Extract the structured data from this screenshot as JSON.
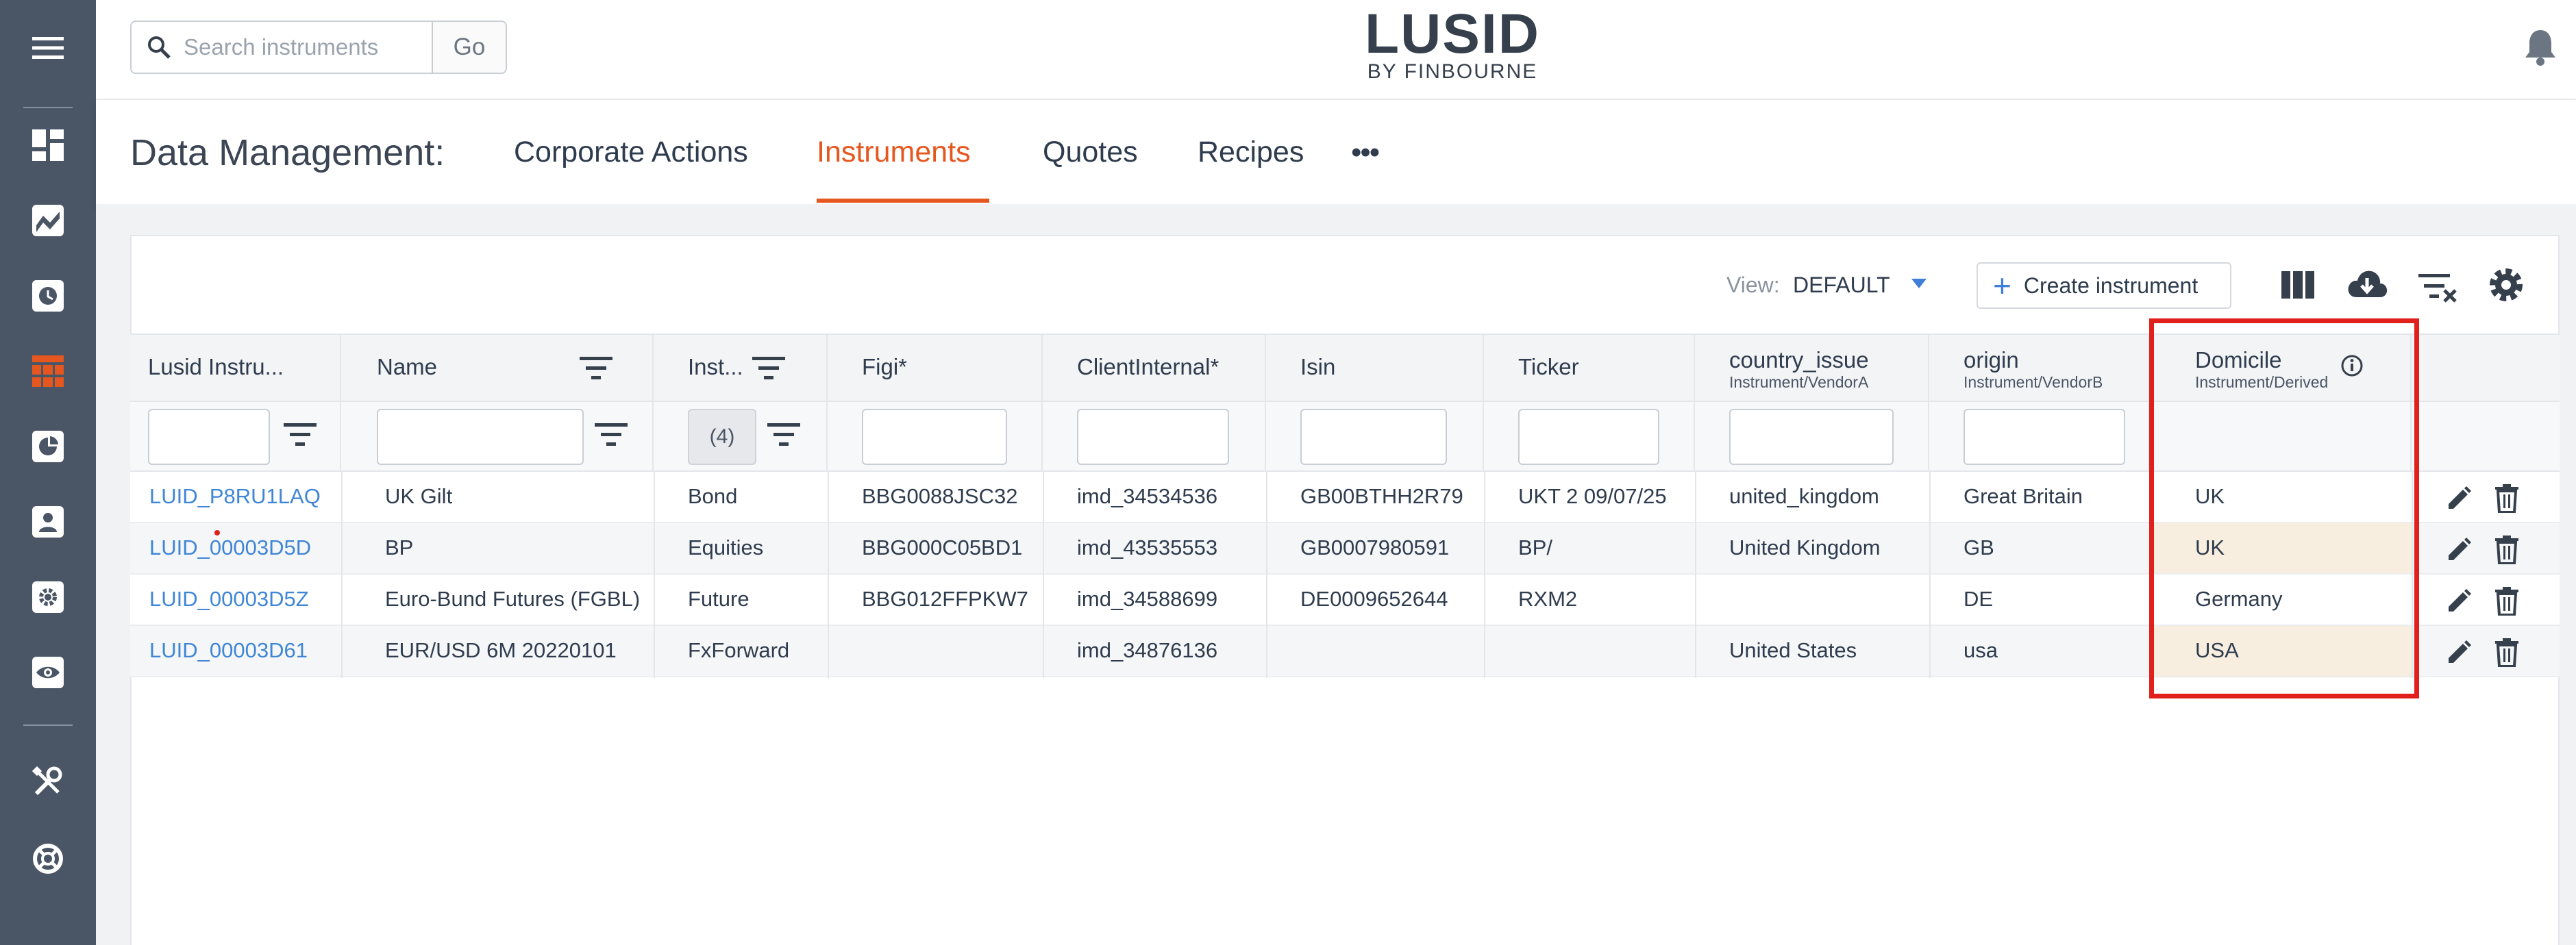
{
  "app": {
    "name": "LUSID",
    "subtitle": "BY FINBOURNE"
  },
  "search": {
    "placeholder": "Search instruments",
    "go_label": "Go"
  },
  "nav": {
    "title": "Data Management:",
    "tabs": [
      {
        "label": "Corporate Actions"
      },
      {
        "label": "Instruments",
        "active": true
      },
      {
        "label": "Quotes"
      },
      {
        "label": "Recipes"
      }
    ],
    "more": "•••"
  },
  "toolbar": {
    "view_label": "View:",
    "view_value": "DEFAULT",
    "create_label": "Create instrument"
  },
  "columns": [
    {
      "label": "Lusid Instru...",
      "sub": ""
    },
    {
      "label": "Name",
      "sub": ""
    },
    {
      "label": "Inst...",
      "sub": ""
    },
    {
      "label": "Figi*",
      "sub": ""
    },
    {
      "label": "ClientInternal*",
      "sub": ""
    },
    {
      "label": "Isin",
      "sub": ""
    },
    {
      "label": "Ticker",
      "sub": ""
    },
    {
      "label": "country_issue",
      "sub": "Instrument/VendorA"
    },
    {
      "label": "origin",
      "sub": "Instrument/VendorB"
    },
    {
      "label": "Domicile",
      "sub": "Instrument/Derived"
    }
  ],
  "filters": {
    "type_count": "(4)"
  },
  "rows": [
    {
      "id": "LUID_P8RU1LAQ",
      "name": "UK Gilt",
      "type": "Bond",
      "figi": "BBG0088JSC32",
      "client": "imd_34534536",
      "isin": "GB00BTHH2R79",
      "ticker": "UKT 2 09/07/25",
      "country": "united_kingdom",
      "origin": "Great Britain",
      "domicile": "UK"
    },
    {
      "id": "LUID_00003D5D",
      "name": "BP",
      "type": "Equities",
      "figi": "BBG000C05BD1",
      "client": "imd_43535553",
      "isin": "GB0007980591",
      "ticker": "BP/",
      "country": "United Kingdom",
      "origin": "GB",
      "domicile": "UK"
    },
    {
      "id": "LUID_00003D5Z",
      "name": "Euro-Bund Futures (FGBL)",
      "type": "Future",
      "figi": "BBG012FFPKW7",
      "client": "imd_34588699",
      "isin": "DE0009652644",
      "ticker": "RXM2",
      "country": "",
      "origin": "DE",
      "domicile": "Germany"
    },
    {
      "id": "LUID_00003D61",
      "name": "EUR/USD 6M 20220101",
      "type": "FxForward",
      "figi": "",
      "client": "imd_34876136",
      "isin": "",
      "ticker": "",
      "country": "United States",
      "origin": "usa",
      "domicile": "USA"
    }
  ],
  "colors": {
    "sidebar": "#4a5565",
    "accent": "#e5571f",
    "link": "#3f86d6",
    "highlight": "#e1201b"
  }
}
